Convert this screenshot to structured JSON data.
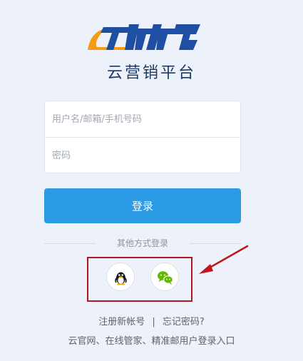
{
  "brand": {
    "logo_text": "领动",
    "subtitle": "云营销平台",
    "logo_colors": [
      "#1e4fa3",
      "#f39c12"
    ]
  },
  "login_form": {
    "username_placeholder": "用户名/邮箱/手机号码",
    "password_placeholder": "密码",
    "login_button_label": "登录"
  },
  "social_login": {
    "label": "其他方式登录",
    "providers": [
      {
        "name": "qq",
        "icon": "qq-penguin-icon"
      },
      {
        "name": "wechat",
        "icon": "wechat-icon",
        "color": "#62b900"
      }
    ],
    "highlight_color": "#b3181c"
  },
  "links": {
    "register": "注册新帐号",
    "separator": "|",
    "forgot_password": "忘记密码?"
  },
  "footer": {
    "text": "云官网、在线管家、精准邮用户登录入口"
  },
  "colors": {
    "background": "#edf1f9",
    "primary": "#2c9be6"
  }
}
